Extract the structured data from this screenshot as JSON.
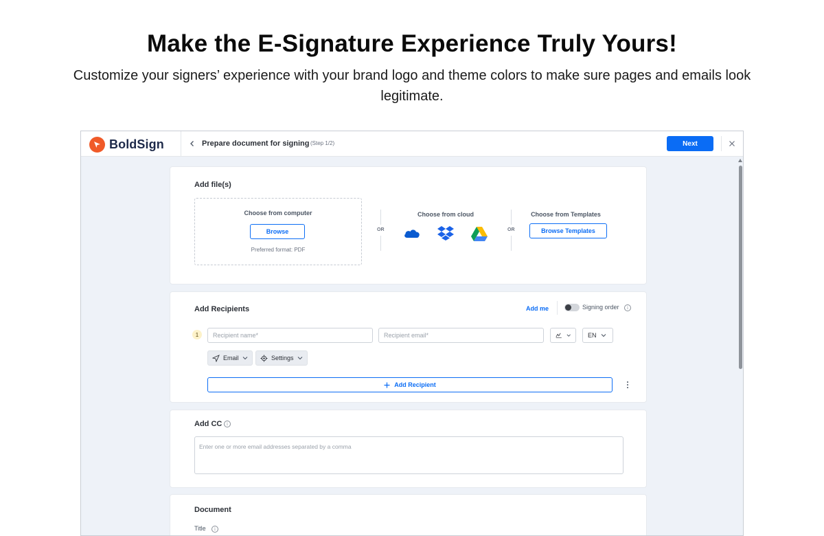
{
  "hero": {
    "title": "Make the E-Signature Experience Truly Yours!",
    "subtitle": "Customize your signers’ experience with your brand logo and theme colors to make sure pages and emails look legitimate."
  },
  "topbar": {
    "brand": "BoldSign",
    "title": "Prepare document for signing",
    "step": "(Step 1/2)",
    "next_label": "Next"
  },
  "files": {
    "title": "Add file(s)",
    "computer_label": "Choose from computer",
    "browse_label": "Browse",
    "format_hint": "Preferred format: PDF",
    "or_label": "OR",
    "cloud_label": "Choose from cloud",
    "cloud_providers": [
      "onedrive",
      "dropbox",
      "google-drive"
    ],
    "templates_label": "Choose from Templates",
    "browse_templates_label": "Browse Templates"
  },
  "recipients": {
    "title": "Add Recipients",
    "add_me_label": "Add me",
    "signing_order_label": "Signing order",
    "row_number": "1",
    "name_placeholder": "Recipient name*",
    "email_placeholder": "Recipient email*",
    "language": "EN",
    "delivery_label": "Email",
    "settings_label": "Settings",
    "add_recipient_label": "Add Recipient"
  },
  "cc": {
    "title": "Add CC",
    "placeholder": "Enter one or more email addresses separated by a comma"
  },
  "document": {
    "title": "Document",
    "field_title_label": "Title"
  },
  "colors": {
    "accent": "#0a6cf5",
    "brand": "#f05a28",
    "background": "#eef2f8"
  }
}
